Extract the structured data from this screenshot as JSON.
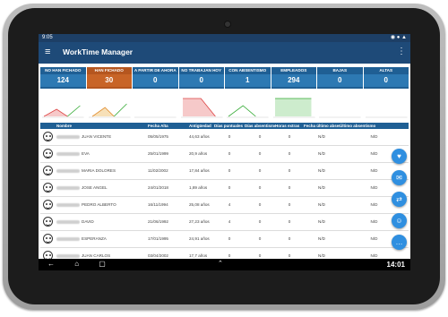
{
  "status": {
    "time": "9:05",
    "icons": "◉ ● ▲"
  },
  "appbar": {
    "title": "WorkTime Manager",
    "menu_icon": "≡",
    "more_icon": "⋮"
  },
  "tiles": [
    {
      "label": "NO HAN FICHADO",
      "value": "124"
    },
    {
      "label": "HAN FICHADO",
      "value": "30"
    },
    {
      "label": "A PARTIR DE AHORA",
      "value": "0"
    },
    {
      "label": "NO TRABAJAN HOY",
      "value": "0"
    },
    {
      "label": "CON ABSENTISMO",
      "value": "1"
    },
    {
      "label": "EMPLEADOS",
      "value": "294"
    },
    {
      "label": "BAJAS",
      "value": "0"
    },
    {
      "label": "ALTAS",
      "value": "0"
    }
  ],
  "table": {
    "headers": [
      "Nombre",
      "Fecha Alta",
      "Antigüedad",
      "Días puntuales",
      "Días absentismo",
      "Horas extras",
      "Fecha último absentismo",
      "Último absentismo"
    ],
    "rows": [
      {
        "name": "JUAN VICENTE",
        "fecha": "05/05/1975",
        "ant": "44,63 años",
        "dp": "0",
        "da": "0",
        "he": "0",
        "fu": "N/D",
        "ua": "N/D"
      },
      {
        "name": "EVA",
        "fecha": "25/01/1999",
        "ant": "20,9 años",
        "dp": "0",
        "da": "0",
        "he": "0",
        "fu": "N/D",
        "ua": "N/D"
      },
      {
        "name": "MARIA DOLORES",
        "fecha": "11/02/2002",
        "ant": "17,84 años",
        "dp": "0",
        "da": "0",
        "he": "0",
        "fu": "N/D",
        "ua": "N/D"
      },
      {
        "name": "JOSE ANGEL",
        "fecha": "24/01/2018",
        "ant": "1,89 años",
        "dp": "0",
        "da": "0",
        "he": "0",
        "fu": "N/D",
        "ua": "N/D"
      },
      {
        "name": "PEDRO ALBERTO",
        "fecha": "16/11/1994",
        "ant": "25,08 años",
        "dp": "4",
        "da": "0",
        "he": "0",
        "fu": "N/D",
        "ua": "N/D"
      },
      {
        "name": "DAVID",
        "fecha": "21/06/1992",
        "ant": "27,23 años",
        "dp": "4",
        "da": "0",
        "he": "0",
        "fu": "N/D",
        "ua": "N/D"
      },
      {
        "name": "ESPERANZA",
        "fecha": "17/01/1995",
        "ant": "24,91 años",
        "dp": "0",
        "da": "0",
        "he": "0",
        "fu": "N/D",
        "ua": "N/D"
      },
      {
        "name": "JUAN CARLOS",
        "fecha": "03/04/2002",
        "ant": "17,7 años",
        "dp": "0",
        "da": "0",
        "he": "0",
        "fu": "N/D",
        "ua": "N/D"
      }
    ]
  },
  "fabs": [
    "♥",
    "✉",
    "⇄",
    "☺",
    "…"
  ],
  "navbar": {
    "clock": "14:01",
    "buttons": "← ⌂ ▢",
    "up": "⌃"
  }
}
